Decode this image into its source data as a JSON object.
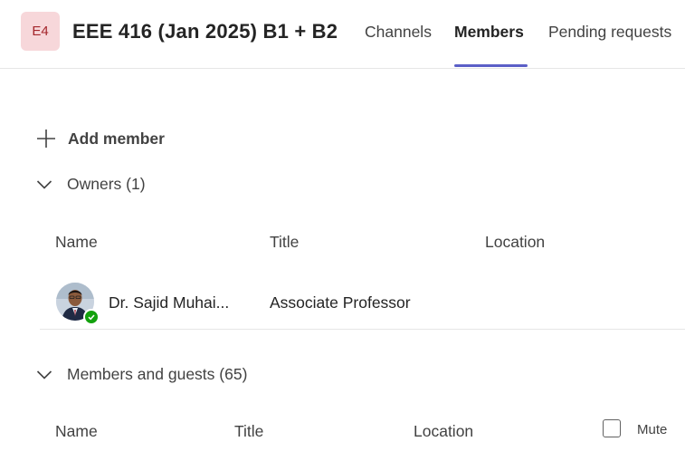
{
  "team": {
    "avatar_initials": "E4",
    "name": "EEE 416 (Jan 2025) B1 + B2",
    "avatar_color": "#f7d7da",
    "avatar_text_color": "#a4262c"
  },
  "tabs": [
    {
      "label": "Channels",
      "active": false
    },
    {
      "label": "Members",
      "active": true
    },
    {
      "label": "Pending requests",
      "active": false
    }
  ],
  "accent_color": "#5b5fc7",
  "add_member": {
    "label": "Add member",
    "icon": "plus-icon"
  },
  "owners": {
    "header": "Owners (1)",
    "columns": [
      "Name",
      "Title",
      "Location"
    ],
    "rows": [
      {
        "name": "Dr. Sajid Muhai...",
        "title": "Associate Professor",
        "location": "",
        "presence": "available"
      }
    ]
  },
  "members": {
    "header": "Members and guests (65)",
    "columns": [
      "Name",
      "Title",
      "Location"
    ],
    "mute_label": "Mute",
    "mute_checked": false
  }
}
